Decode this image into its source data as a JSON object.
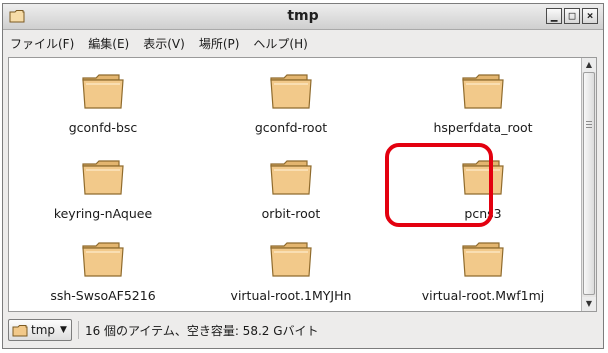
{
  "window": {
    "title": "tmp",
    "icon": "folder-icon",
    "buttons": [
      "minimize-icon",
      "maximize-icon",
      "close-icon"
    ]
  },
  "menubar": {
    "items": [
      {
        "label": "ファイル(F)"
      },
      {
        "label": "編集(E)"
      },
      {
        "label": "表示(V)"
      },
      {
        "label": "場所(P)"
      },
      {
        "label": "ヘルプ(H)"
      }
    ]
  },
  "files": [
    {
      "name": "gconfd-bsc"
    },
    {
      "name": "gconfd-root"
    },
    {
      "name": "hsperfdata_root"
    },
    {
      "name": "keyring-nAquee"
    },
    {
      "name": "orbit-root"
    },
    {
      "name": "pcns3"
    },
    {
      "name": "ssh-SwsoAF5216"
    },
    {
      "name": "virtual-root.1MYJHn"
    },
    {
      "name": "virtual-root.Mwf1mj"
    }
  ],
  "highlight": {
    "color": "#e3000f",
    "target": "pcns3"
  },
  "statusbar": {
    "location_label": "tmp",
    "status_text": "16 個のアイテム、空き容量: 58.2 Gバイト"
  },
  "colors": {
    "folder_fill": "#f2c98a",
    "folder_stroke": "#8f6b2d"
  }
}
